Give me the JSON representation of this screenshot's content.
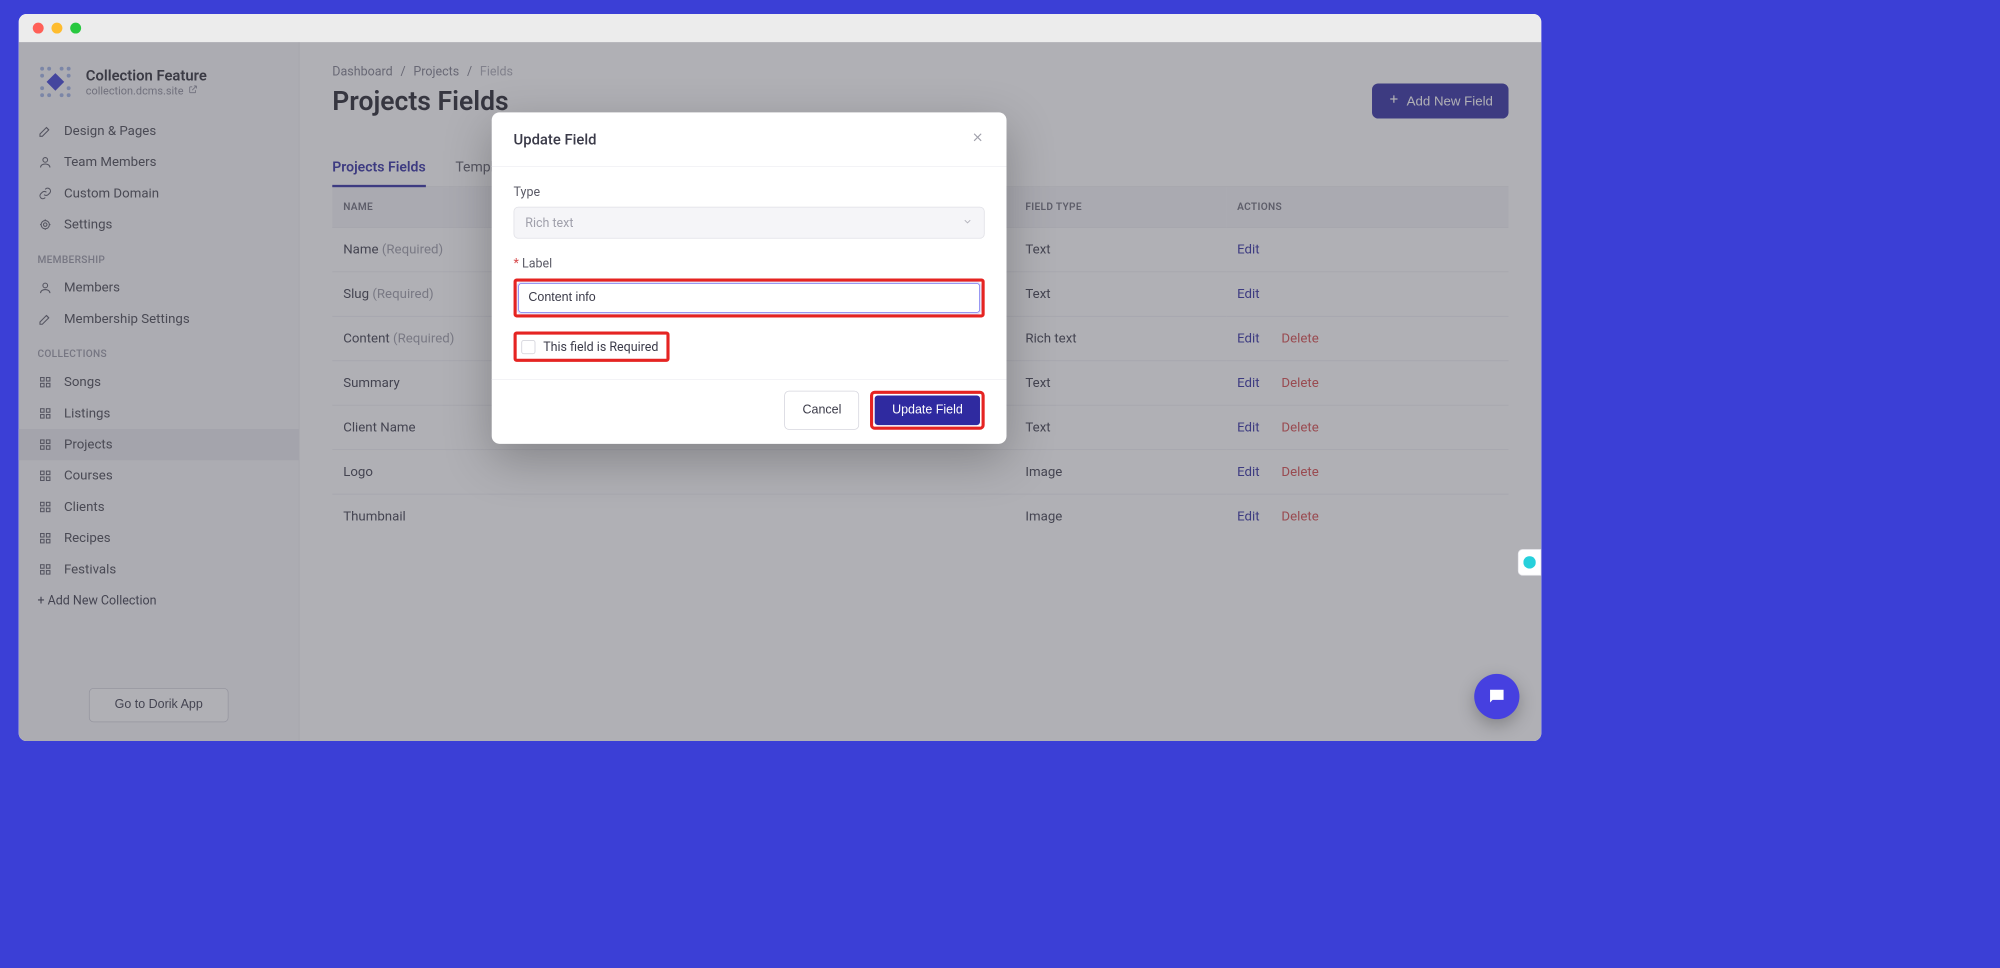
{
  "window": {
    "product_title": "Collection Feature",
    "product_subtitle": "collection.dcms.site"
  },
  "sidebar": {
    "main": [
      {
        "label": "Design & Pages",
        "icon": "pencil-icon"
      },
      {
        "label": "Team Members",
        "icon": "user-icon"
      },
      {
        "label": "Custom Domain",
        "icon": "link-icon"
      },
      {
        "label": "Settings",
        "icon": "gear-icon"
      }
    ],
    "membership_heading": "MEMBERSHIP",
    "membership": [
      {
        "label": "Members",
        "icon": "user-icon"
      },
      {
        "label": "Membership Settings",
        "icon": "pencil-icon"
      }
    ],
    "collections_heading": "COLLECTIONS",
    "collections": [
      {
        "label": "Songs"
      },
      {
        "label": "Listings"
      },
      {
        "label": "Projects",
        "active": true
      },
      {
        "label": "Courses"
      },
      {
        "label": "Clients"
      },
      {
        "label": "Recipes"
      },
      {
        "label": "Festivals"
      }
    ],
    "add_collection": "+ Add New Collection",
    "go_to_app": "Go to Dorik App"
  },
  "breadcrumb": [
    "Dashboard",
    "Projects",
    "Fields"
  ],
  "page_title": "Projects Fields",
  "add_button": "Add New Field",
  "tabs": [
    {
      "label": "Projects Fields",
      "active": true
    },
    {
      "label": "Template"
    }
  ],
  "table": {
    "headers": {
      "name": "NAME",
      "type": "FIELD TYPE",
      "actions": "ACTIONS"
    },
    "rows": [
      {
        "name": "Name",
        "required": true,
        "type": "Text",
        "deletable": false
      },
      {
        "name": "Slug",
        "required": true,
        "type": "Text",
        "deletable": false
      },
      {
        "name": "Content",
        "required": true,
        "type": "Rich text",
        "deletable": true
      },
      {
        "name": "Summary",
        "required": false,
        "type": "Text",
        "deletable": true
      },
      {
        "name": "Client Name",
        "required": false,
        "type": "Text",
        "deletable": true
      },
      {
        "name": "Logo",
        "required": false,
        "type": "Image",
        "deletable": true
      },
      {
        "name": "Thumbnail",
        "required": false,
        "type": "Image",
        "deletable": true
      }
    ],
    "required_suffix": "(Required)",
    "edit_label": "Edit",
    "delete_label": "Delete"
  },
  "modal": {
    "title": "Update Field",
    "type_label": "Type",
    "type_value": "Rich text",
    "label_label": "Label",
    "label_value": "Content info",
    "required_checkbox": "This field is Required",
    "cancel": "Cancel",
    "submit": "Update Field"
  }
}
